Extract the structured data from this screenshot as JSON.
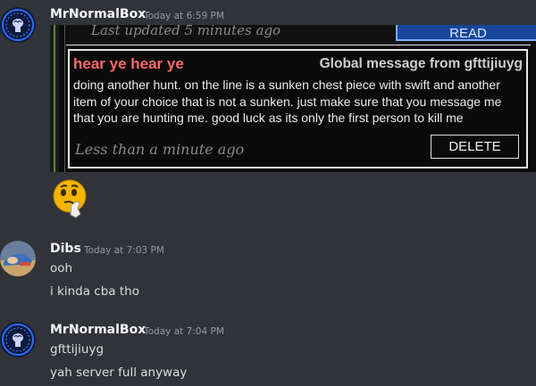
{
  "messages": [
    {
      "author": "MrNormalBox",
      "timestamp": "Today at 6:59 PM",
      "avatar_icon": "brain-circle-icon",
      "attachment": {
        "last_updated": "Last updated 5 minutes ago",
        "read_button": "READ",
        "global_message": {
          "title": "hear ye hear ye",
          "from": "Global message from gfttijiuyg",
          "body": "doing another hunt. on the line is a sunken chest piece with swift and another item of your choice that is not a sunken. just make sure that you message me that you are hunting me. good luck as its only the first person to kill me",
          "time": "Less than a minute ago",
          "delete_button": "DELETE"
        }
      },
      "sticker_icon": "thinking-emoji-icon"
    },
    {
      "author": "Dibs",
      "timestamp": "Today at 7:03 PM",
      "avatar_icon": "dibs-avatar-icon",
      "lines": [
        "ooh",
        "i kinda cba tho"
      ]
    },
    {
      "author": "MrNormalBox",
      "timestamp": "Today at 7:04 PM",
      "avatar_icon": "brain-circle-icon",
      "lines": [
        "gfttijiuyg",
        "yah server full anyway"
      ]
    }
  ],
  "colors": {
    "background": "#313338",
    "title_red": "#ff6b6b",
    "read_button_blue": "#17469c"
  }
}
